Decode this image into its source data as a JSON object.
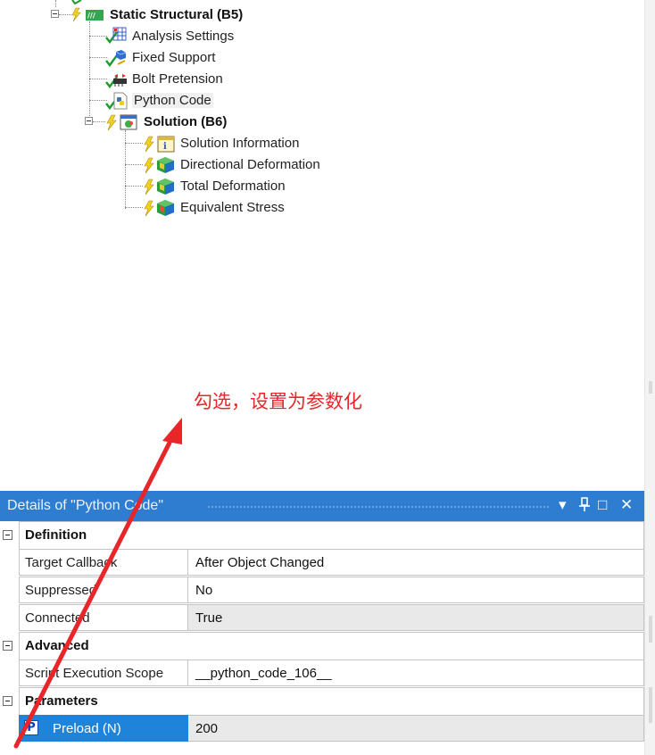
{
  "tree": {
    "static_structural": "Static Structural (B5)",
    "analysis_settings": "Analysis Settings",
    "fixed_support": "Fixed Support",
    "bolt_pretension": "Bolt Pretension",
    "python_code": "Python Code",
    "solution": "Solution (B6)",
    "solution_information": "Solution Information",
    "directional_deformation": "Directional Deformation",
    "total_deformation": "Total Deformation",
    "equivalent_stress": "Equivalent Stress"
  },
  "annotation": {
    "text": "勾选，设置为参数化",
    "color": "#e8262a"
  },
  "details": {
    "title": "Details of \"Python Code\"",
    "controls": {
      "dropdown": "▾",
      "pin": "⊥",
      "maximize": "□",
      "close": "✕"
    },
    "categories": {
      "definition": "Definition",
      "advanced": "Advanced",
      "parameters": "Parameters"
    },
    "rows": {
      "target_callback": {
        "key": "Target Callback",
        "value": "After Object Changed"
      },
      "suppressed": {
        "key": "Suppressed",
        "value": "No"
      },
      "connected": {
        "key": "Connected",
        "value": "True"
      },
      "script_scope": {
        "key": "Script Execution Scope",
        "value": "__python_code_106__"
      },
      "preload": {
        "badge": "P",
        "key": "Preload (N)",
        "value": "200"
      }
    }
  },
  "colors": {
    "title_bar": "#2f7dd1",
    "selection": "#1f83d9",
    "readonly": "#e9e9e9"
  },
  "icons": [
    "check-icon",
    "lightning-icon",
    "static-structural-icon",
    "analysis-settings-icon",
    "fixed-support-icon",
    "bolt-pretension-icon",
    "python-code-icon",
    "solution-icon",
    "solution-information-icon",
    "deformation-result-icon",
    "stress-result-icon"
  ]
}
